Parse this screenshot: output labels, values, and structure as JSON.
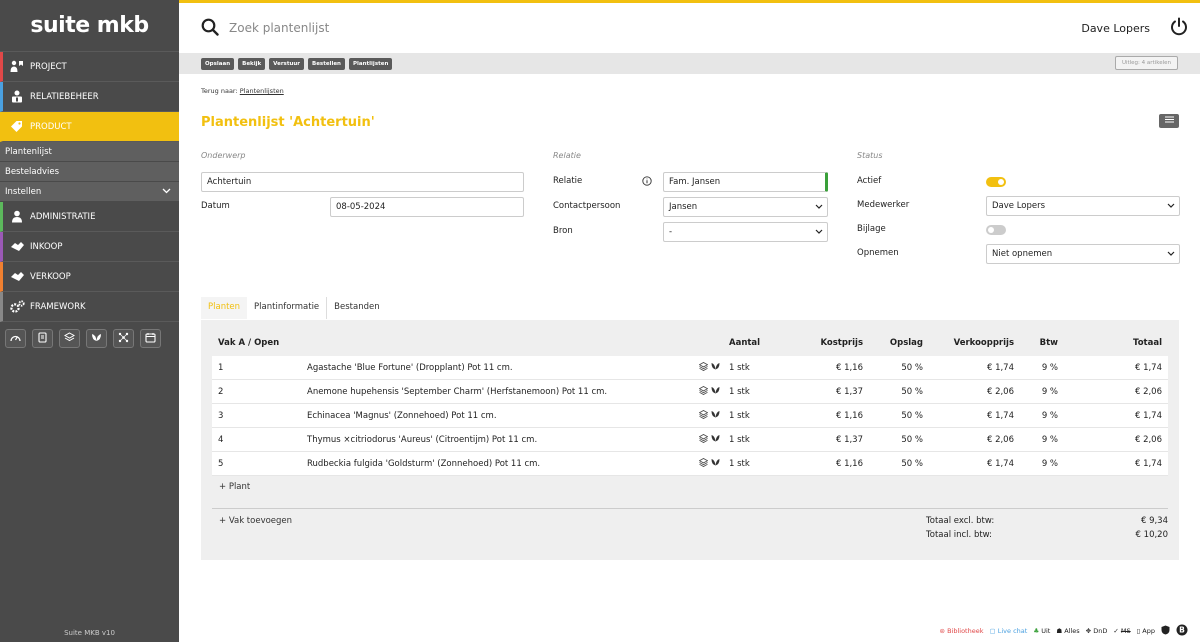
{
  "app": {
    "logo": "suite mkb",
    "version": "Suite MKB v10"
  },
  "sidebar": {
    "items": [
      {
        "label": "PROJECT",
        "icon": "person-pin-icon"
      },
      {
        "label": "RELATIEBEHEER",
        "icon": "contacts-icon"
      },
      {
        "label": "PRODUCT",
        "icon": "tag-icon"
      },
      {
        "label": "ADMINISTRATIE",
        "icon": "user-icon"
      },
      {
        "label": "INKOOP",
        "icon": "handshake-icon"
      },
      {
        "label": "VERKOOP",
        "icon": "handshake-icon"
      },
      {
        "label": "FRAMEWORK",
        "icon": "gears-icon"
      }
    ],
    "subitems": [
      {
        "label": "Plantenlijst"
      },
      {
        "label": "Besteladvies"
      },
      {
        "label": "Instellen"
      }
    ]
  },
  "search": {
    "placeholder": "Zoek plantenlijst"
  },
  "user": {
    "name": "Dave Lopers"
  },
  "toolbar": {
    "buttons": [
      "Opslaan",
      "Bekijk",
      "Verstuur",
      "Bestellen",
      "Plantlijsten"
    ],
    "uitleg": "Uitleg: 4 artikelen"
  },
  "breadcrumb": {
    "prefix": "Terug naar:",
    "link": "Plantenlijsten"
  },
  "page": {
    "title": "Plantenlijst 'Achtertuin'"
  },
  "form": {
    "onderwerp": {
      "section": "Onderwerp",
      "value": "Achtertuin"
    },
    "datum": {
      "label": "Datum",
      "value": "08-05-2024"
    },
    "relatie": {
      "section": "Relatie",
      "label": "Relatie",
      "value": "Fam. Jansen"
    },
    "contactpersoon": {
      "label": "Contactpersoon",
      "value": "Jansen"
    },
    "bron": {
      "label": "Bron",
      "value": "-"
    },
    "status": {
      "section": "Status"
    },
    "actief": {
      "label": "Actief",
      "on": true
    },
    "medewerker": {
      "label": "Medewerker",
      "value": "Dave Lopers"
    },
    "bijlage": {
      "label": "Bijlage",
      "on": false
    },
    "opnemen": {
      "label": "Opnemen",
      "value": "Niet opnemen"
    }
  },
  "tabs": [
    "Planten",
    "Plantinformatie",
    "Bestanden"
  ],
  "table": {
    "headers": {
      "vak": "Vak A / Open",
      "aantal": "Aantal",
      "kostprijs": "Kostprijs",
      "opslag": "Opslag",
      "verkoopprijs": "Verkoopprijs",
      "btw": "Btw",
      "totaal": "Totaal"
    },
    "rows": [
      {
        "nr": "1",
        "name": "Agastache 'Blue Fortune' (Dropplant) Pot 11 cm.",
        "aantal": "1 stk",
        "kost": "€ 1,16",
        "opslag": "50 %",
        "verk": "€ 1,74",
        "btw": "9 %",
        "tot": "€ 1,74"
      },
      {
        "nr": "2",
        "name": "Anemone hupehensis 'September Charm' (Herfstanemoon) Pot 11 cm.",
        "aantal": "1 stk",
        "kost": "€ 1,37",
        "opslag": "50 %",
        "verk": "€ 2,06",
        "btw": "9 %",
        "tot": "€ 2,06"
      },
      {
        "nr": "3",
        "name": "Echinacea 'Magnus' (Zonnehoed) Pot 11 cm.",
        "aantal": "1 stk",
        "kost": "€ 1,16",
        "opslag": "50 %",
        "verk": "€ 1,74",
        "btw": "9 %",
        "tot": "€ 1,74"
      },
      {
        "nr": "4",
        "name": "Thymus ×citriodorus 'Aureus' (Citroentijm) Pot 11 cm.",
        "aantal": "1 stk",
        "kost": "€ 1,37",
        "opslag": "50 %",
        "verk": "€ 2,06",
        "btw": "9 %",
        "tot": "€ 2,06"
      },
      {
        "nr": "5",
        "name": "Rudbeckia fulgida 'Goldsturm' (Zonnehoed) Pot 11 cm.",
        "aantal": "1 stk",
        "kost": "€ 1,16",
        "opslag": "50 %",
        "verk": "€ 1,74",
        "btw": "9 %",
        "tot": "€ 1,74"
      }
    ],
    "add_plant": "+ Plant",
    "add_vak": "+ Vak toevoegen",
    "totals": {
      "excl_label": "Totaal excl. btw:",
      "excl_value": "€ 9,34",
      "incl_label": "Totaal incl. btw:",
      "incl_value": "€ 10,20"
    }
  },
  "footer": {
    "bibliotheek": "Bibliotheek",
    "livechat": "Live chat",
    "uit": "Uit",
    "alles": "Alles",
    "dnd": "DnD",
    "ms": "MS",
    "app": "App"
  },
  "colors": {
    "accent": "#f2c010",
    "sidebar": "#4a4a4a"
  }
}
